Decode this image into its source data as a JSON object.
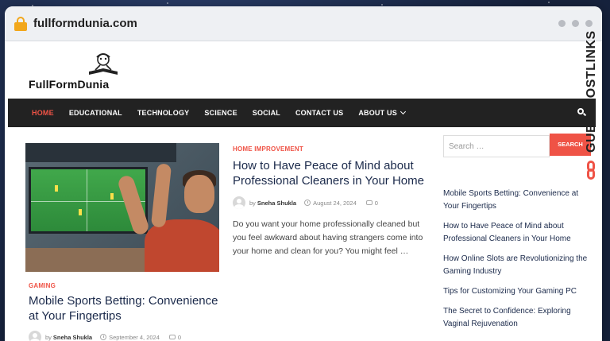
{
  "browser": {
    "url": "fullformdunia.com"
  },
  "site": {
    "logo_text": "FullFormDunia"
  },
  "nav": {
    "items": [
      {
        "label": "HOME",
        "active": true
      },
      {
        "label": "EDUCATIONAL"
      },
      {
        "label": "TECHNOLOGY"
      },
      {
        "label": "SCIENCE"
      },
      {
        "label": "SOCIAL"
      },
      {
        "label": "CONTACT US"
      },
      {
        "label": "ABOUT US"
      }
    ]
  },
  "articles": [
    {
      "category": "HOME IMPROVEMENT",
      "title": "How to Have Peace of Mind about Professional Cleaners in Your Home",
      "author": "Sneha Shukla",
      "date": "August 24, 2024",
      "comments": "0",
      "excerpt": "Do you want your home professionally cleaned but you feel awkward about having strangers come into your home and clean for you? You might feel …"
    },
    {
      "category": "GAMING",
      "title": "Mobile Sports Betting: Convenience at Your Fingertips",
      "author": "Sneha Shukla",
      "date": "September 4, 2024",
      "comments": "0"
    }
  ],
  "byline_prefix": "by",
  "sidebar": {
    "search_placeholder": "Search …",
    "search_button": "SEARCH",
    "recent_posts": [
      "Mobile Sports Betting: Convenience at Your Fingertips",
      "How to Have Peace of Mind about Professional Cleaners in Your Home",
      "How Online Slots are Revolutionizing the Gaming Industry",
      "Tips for Customizing Your Gaming PC",
      "The Secret to Confidence: Exploring Vaginal Rejuvenation"
    ]
  },
  "badge": {
    "text": "GUESTPOSTLINKS"
  },
  "colors": {
    "accent": "#ef5346",
    "nav_bg": "#222222",
    "title": "#1b2a4b"
  }
}
